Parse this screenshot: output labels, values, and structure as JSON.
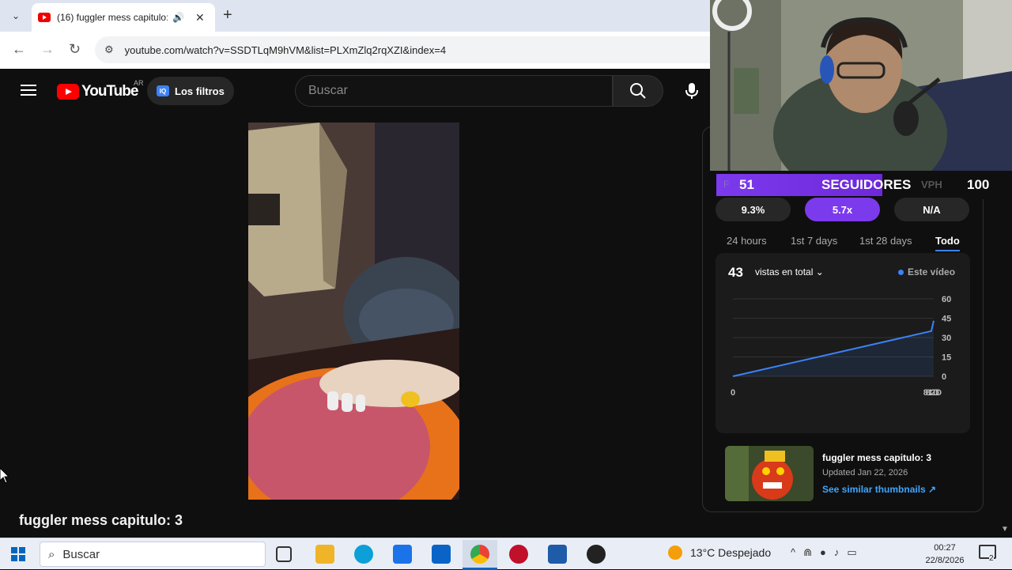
{
  "browser": {
    "tab_title": "(16) fuggler mess capitulo: 3",
    "new_tab": "+",
    "url": "youtube.com/watch?v=SSDTLqM9hVM&list=PLXmZlq2rqXZI&index=4"
  },
  "youtube": {
    "logo_text": "YouTube",
    "country": "AR",
    "filters_icon": "IQ",
    "filters_label": "Los filtros",
    "search_placeholder": "Buscar",
    "video_title": "fuggler mess capitulo: 3"
  },
  "overlay": {
    "followers_count": "51",
    "followers_label": "SEGUIDORES",
    "f_letter": "F",
    "vph_label": "VPH",
    "vph_value": "100"
  },
  "stats": {
    "chips": [
      "9.3%",
      "5.7x",
      "N/A"
    ],
    "range_tabs": [
      "24 hours",
      "1st 7 days",
      "1st 28 days",
      "Todo"
    ],
    "active_tab": "Todo"
  },
  "views_card": {
    "total": "43",
    "label": "vistas en total",
    "legend": "Este vídeo"
  },
  "chart_data": {
    "type": "line",
    "x_labels": [
      "0",
      "81D",
      "82D"
    ],
    "y_ticks": [
      60,
      45,
      30,
      15,
      0
    ],
    "ylim": [
      0,
      60
    ],
    "series": [
      {
        "name": "Este vídeo",
        "x": [
          0,
          81,
          82
        ],
        "values": [
          0,
          35,
          43
        ]
      }
    ],
    "grid": true,
    "color": "#3b82f6"
  },
  "related": {
    "title": "fuggler mess capitulo: 3",
    "updated": "Updated Jan 22, 2026",
    "similar": "See similar thumbnails ↗"
  },
  "taskbar": {
    "search_label": "Buscar",
    "weather": "13°C  Despejado",
    "time": "00:27",
    "date": "22/8/2026",
    "notifications": "2"
  }
}
